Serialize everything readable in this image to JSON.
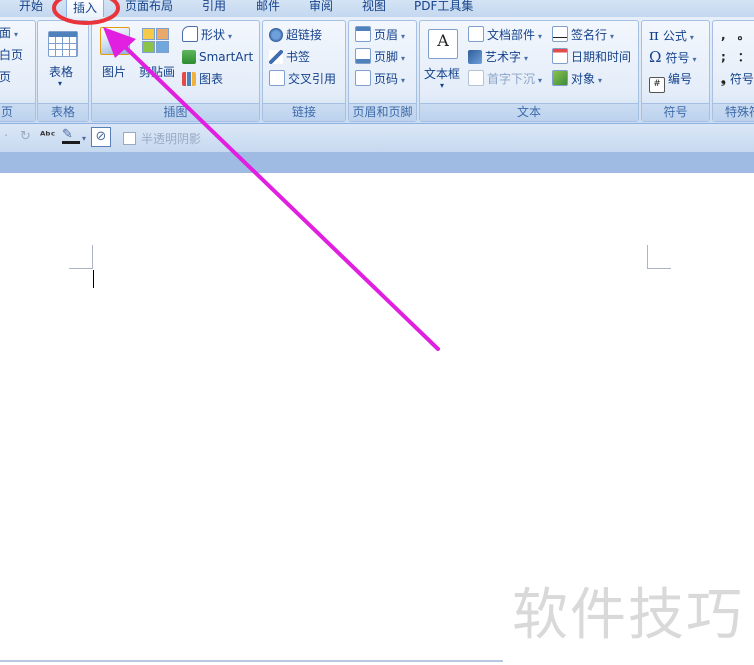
{
  "tabs": [
    "开始",
    "插入",
    "页面布局",
    "引用",
    "邮件",
    "审阅",
    "视图",
    "PDF工具集"
  ],
  "active_tab": "插入",
  "groups": {
    "page": {
      "items": [
        "面",
        "白页",
        "页"
      ],
      "title": "页"
    },
    "table": {
      "label": "表格",
      "title": "表格"
    },
    "illustration": {
      "picture": "图片",
      "clipart": "剪贴画",
      "shape": "形状",
      "smartart": "SmartArt",
      "chart": "图表",
      "title": "插图"
    },
    "links": {
      "hyperlink": "超链接",
      "bookmark": "书签",
      "crossref": "交叉引用",
      "title": "链接"
    },
    "headerfooter": {
      "header": "页眉",
      "footer": "页脚",
      "pagenum": "页码",
      "title": "页眉和页脚"
    },
    "text": {
      "textbox": "文本框",
      "parts": "文档部件",
      "wordart": "艺术字",
      "dropcap": "首字下沉",
      "sigline": "签名行",
      "datetime": "日期和时间",
      "object": "对象",
      "title": "文本"
    },
    "symbols": {
      "formula": "公式",
      "symbol": "符号",
      "number": "编号",
      "title": "符号"
    },
    "special": {
      "items": [
        ",",
        ";",
        "符号"
      ],
      "title": "特殊符"
    }
  },
  "qat": {
    "checkbox_label": "半透明阴影"
  },
  "document": {
    "watermark": "软件技巧"
  },
  "colors": {
    "annotation": "#e01fe0",
    "ribbon_text": "#15428b"
  }
}
